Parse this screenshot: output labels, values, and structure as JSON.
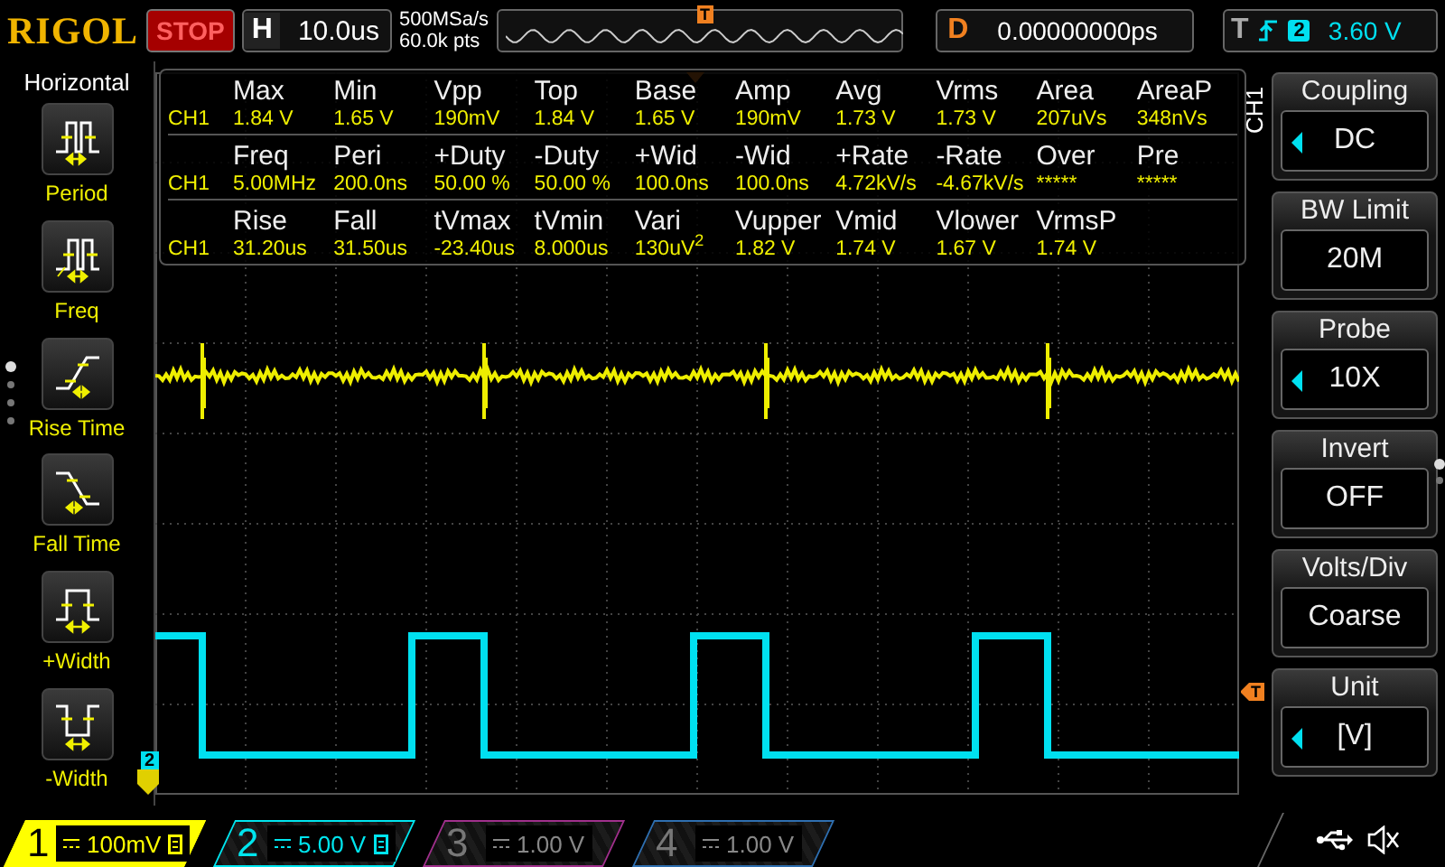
{
  "top_bar": {
    "brand": "RIGOL",
    "run_state": "STOP",
    "timebase": {
      "label": "H",
      "value": "10.0us"
    },
    "sample_rate": "500MSa/s",
    "memory_depth": "60.0k pts",
    "trigger_position": "T",
    "delay": {
      "label": "D",
      "value": "0.00000000ps"
    },
    "trigger": {
      "label": "T",
      "source": "2",
      "level": "3.60 V"
    }
  },
  "left_menu": {
    "title": "Horizontal",
    "items": [
      {
        "kind": "period",
        "label": "Period"
      },
      {
        "kind": "freq",
        "label": "Freq"
      },
      {
        "kind": "rise",
        "label": "Rise Time"
      },
      {
        "kind": "fall",
        "label": "Fall Time"
      },
      {
        "kind": "pwidth",
        "label": "+Width"
      },
      {
        "kind": "nwidth",
        "label": "-Width"
      }
    ]
  },
  "measurements": {
    "rows": [
      {
        "headers": [
          "Max",
          "Min",
          "Vpp",
          "Top",
          "Base",
          "Amp",
          "Avg",
          "Vrms",
          "Area",
          "AreaP"
        ],
        "channel": "CH1",
        "values": [
          "1.84 V",
          "1.65 V",
          "190mV",
          "1.84 V",
          "1.65 V",
          "190mV",
          "1.73 V",
          "1.73 V",
          "207uVs",
          "348nVs"
        ]
      },
      {
        "headers": [
          "Freq",
          "Peri",
          "+Duty",
          "-Duty",
          "+Wid",
          "-Wid",
          "+Rate",
          "-Rate",
          "Over",
          "Pre"
        ],
        "channel": "CH1",
        "values": [
          "5.00MHz",
          "200.0ns",
          "50.00 %",
          "50.00 %",
          "100.0ns",
          "100.0ns",
          "4.72kV/s",
          "-4.67kV/s",
          "*****",
          "*****"
        ]
      },
      {
        "headers": [
          "Rise",
          "Fall",
          "tVmax",
          "tVmin",
          "Vari",
          "Vupper",
          "Vmid",
          "Vlower",
          "VrmsP"
        ],
        "channel": "CH1",
        "values": [
          "31.20us",
          "31.50us",
          "-23.40us",
          "8.000us",
          {
            "text": "130uV$^{2}$",
            "markup": true
          },
          "1.82 V",
          "1.74 V",
          "1.67 V",
          "1.74 V"
        ]
      }
    ]
  },
  "plot": {
    "channel_marker": "2",
    "trigger_level_marker": "T"
  },
  "channel_menu": {
    "title": "CH1",
    "items": [
      {
        "title": "Coupling",
        "value": "DC",
        "adjustable": true
      },
      {
        "title": "BW Limit",
        "value": "20M",
        "adjustable": false
      },
      {
        "title": "Probe",
        "value": "10X",
        "adjustable": true
      },
      {
        "title": "Invert",
        "value": "OFF",
        "adjustable": false
      },
      {
        "title": "Volts/Div",
        "value": "Coarse",
        "adjustable": false
      },
      {
        "title": "Unit",
        "value": "[V]",
        "adjustable": true
      }
    ]
  },
  "channels": [
    {
      "number": "1",
      "scale": "100mV",
      "selected": true,
      "on": true,
      "color": "#ffff00"
    },
    {
      "number": "2",
      "scale": "5.00 V",
      "selected": false,
      "on": true,
      "color": "#00e5ee"
    },
    {
      "number": "3",
      "scale": "1.00 V",
      "selected": false,
      "on": false,
      "color": "#a0308c"
    },
    {
      "number": "4",
      "scale": "1.00 V",
      "selected": false,
      "on": false,
      "color": "#2f6fb0"
    }
  ]
}
